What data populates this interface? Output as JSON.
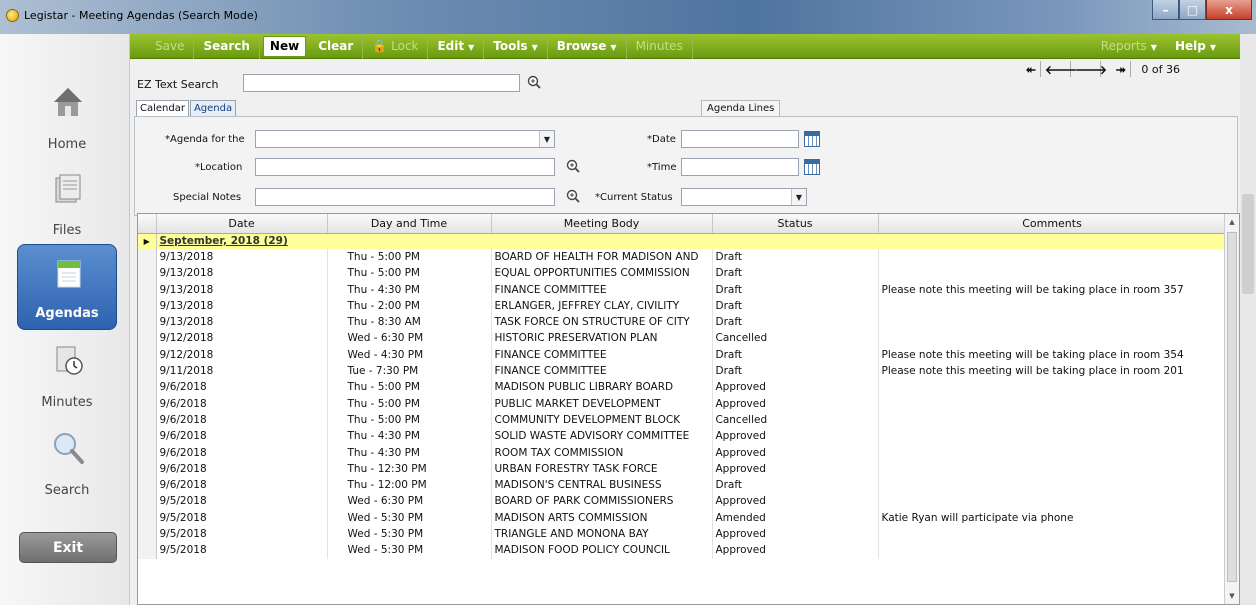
{
  "window": {
    "title": "Legistar - Meeting Agendas (Search Mode)",
    "minimize": "–",
    "maximize": "□",
    "close": "x"
  },
  "nav": {
    "home": "Home",
    "files": "Files",
    "agendas": "Agendas",
    "minutes": "Minutes",
    "search": "Search",
    "exit": "Exit"
  },
  "toolbar": {
    "save": "Save",
    "search": "Search",
    "new": "New",
    "clear": "Clear",
    "lock": "Lock",
    "edit": "Edit",
    "tools": "Tools",
    "browse": "Browse",
    "minutes": "Minutes",
    "reports": "Reports",
    "help": "Help"
  },
  "search": {
    "label": "EZ Text Search",
    "value": "",
    "pager_text": "0 of 36"
  },
  "tabs": {
    "calendar": "Calendar",
    "agenda": "Agenda",
    "agenda_lines": "Agenda Lines"
  },
  "form": {
    "agenda_for": "*Agenda for the",
    "location": "*Location",
    "special_notes": "Special Notes",
    "date": "*Date",
    "time": "*Time",
    "current_status": "*Current Status"
  },
  "grid": {
    "columns": [
      "Date",
      "Day and Time",
      "Meeting Body",
      "Status",
      "Comments"
    ],
    "group_label": "September, 2018 (29)",
    "rows": [
      {
        "date": "9/13/2018",
        "day": "Thu - 5:00 PM",
        "body": "BOARD OF HEALTH FOR MADISON AND",
        "status": "Draft",
        "comments": ""
      },
      {
        "date": "9/13/2018",
        "day": "Thu - 5:00 PM",
        "body": "EQUAL OPPORTUNITIES COMMISSION",
        "status": "Draft",
        "comments": ""
      },
      {
        "date": "9/13/2018",
        "day": "Thu - 4:30 PM",
        "body": "FINANCE COMMITTEE",
        "status": "Draft",
        "comments": "Please note this meeting will be taking place in room 357"
      },
      {
        "date": "9/13/2018",
        "day": "Thu - 2:00 PM",
        "body": "ERLANGER, JEFFREY CLAY, CIVILITY",
        "status": "Draft",
        "comments": ""
      },
      {
        "date": "9/13/2018",
        "day": "Thu - 8:30 AM",
        "body": "TASK FORCE ON STRUCTURE OF CITY",
        "status": "Draft",
        "comments": ""
      },
      {
        "date": "9/12/2018",
        "day": "Wed - 6:30 PM",
        "body": "HISTORIC PRESERVATION PLAN",
        "status": "Cancelled",
        "comments": ""
      },
      {
        "date": "9/12/2018",
        "day": "Wed - 4:30 PM",
        "body": "FINANCE COMMITTEE",
        "status": "Draft",
        "comments": "Please note this meeting will be taking place in room 354"
      },
      {
        "date": "9/11/2018",
        "day": "Tue - 7:30 PM",
        "body": "FINANCE COMMITTEE",
        "status": "Draft",
        "comments": "Please note this meeting will be taking place in room 201"
      },
      {
        "date": "9/6/2018",
        "day": "Thu - 5:00 PM",
        "body": "MADISON PUBLIC LIBRARY BOARD",
        "status": "Approved",
        "comments": ""
      },
      {
        "date": "9/6/2018",
        "day": "Thu - 5:00 PM",
        "body": "PUBLIC MARKET DEVELOPMENT",
        "status": "Approved",
        "comments": ""
      },
      {
        "date": "9/6/2018",
        "day": "Thu - 5:00 PM",
        "body": "COMMUNITY DEVELOPMENT BLOCK",
        "status": "Cancelled",
        "comments": ""
      },
      {
        "date": "9/6/2018",
        "day": "Thu - 4:30 PM",
        "body": "SOLID WASTE ADVISORY COMMITTEE",
        "status": "Approved",
        "comments": ""
      },
      {
        "date": "9/6/2018",
        "day": "Thu - 4:30 PM",
        "body": "ROOM TAX COMMISSION",
        "status": "Approved",
        "comments": ""
      },
      {
        "date": "9/6/2018",
        "day": "Thu - 12:30 PM",
        "body": "URBAN FORESTRY TASK FORCE",
        "status": "Approved",
        "comments": ""
      },
      {
        "date": "9/6/2018",
        "day": "Thu - 12:00 PM",
        "body": "MADISON'S CENTRAL BUSINESS",
        "status": "Draft",
        "comments": ""
      },
      {
        "date": "9/5/2018",
        "day": "Wed - 6:30 PM",
        "body": "BOARD OF PARK COMMISSIONERS",
        "status": "Approved",
        "comments": ""
      },
      {
        "date": "9/5/2018",
        "day": "Wed - 5:30 PM",
        "body": "MADISON ARTS COMMISSION",
        "status": "Amended",
        "comments": "Katie Ryan will participate via phone"
      },
      {
        "date": "9/5/2018",
        "day": "Wed - 5:30 PM",
        "body": "TRIANGLE AND MONONA BAY",
        "status": "Approved",
        "comments": ""
      },
      {
        "date": "9/5/2018",
        "day": "Wed - 5:30 PM",
        "body": "MADISON FOOD POLICY COUNCIL",
        "status": "Approved",
        "comments": ""
      }
    ]
  },
  "colors": {
    "toolbar": "#7fac1c",
    "nav_active": "#3a73c0",
    "group_row": "#ffff99"
  }
}
